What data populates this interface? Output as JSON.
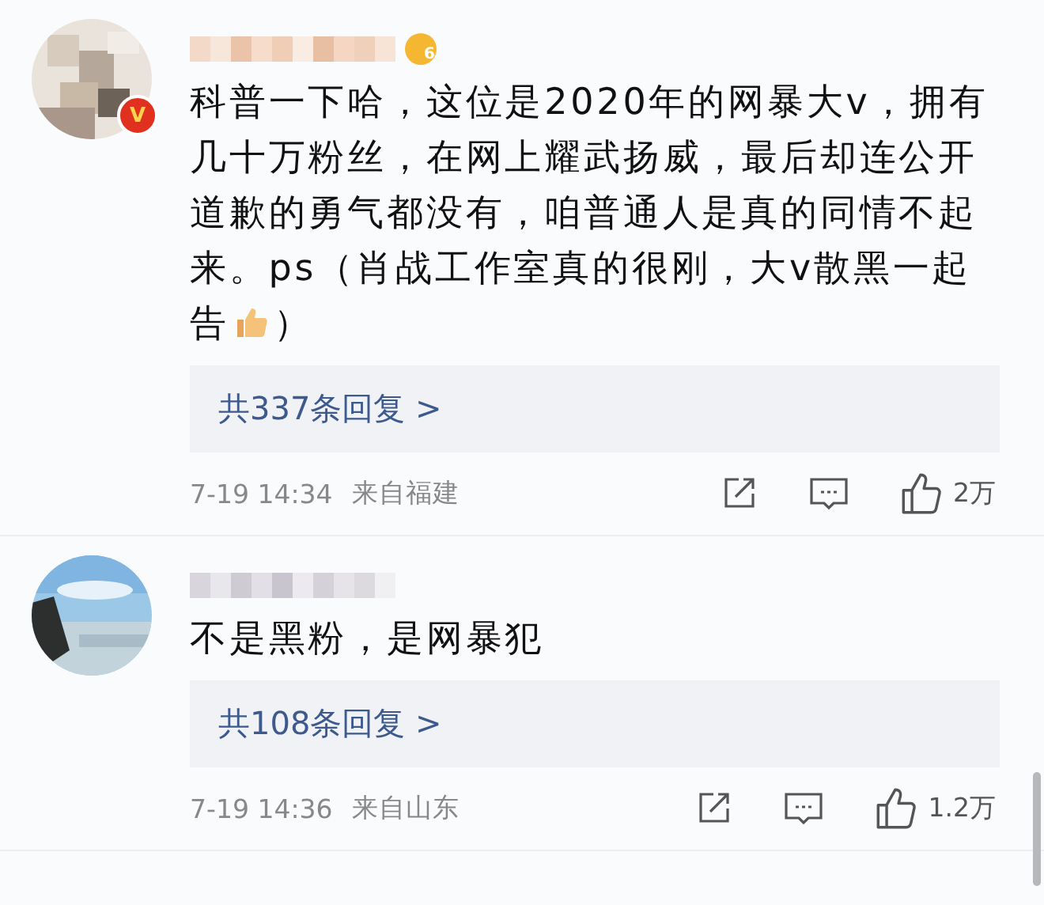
{
  "comments": [
    {
      "avatar": {
        "verified": true,
        "verified_mark": "V"
      },
      "level_badge": "6",
      "text": "科普一下哈，这位是2020年的网暴大v，拥有几十万粉丝，在网上耀武扬威，最后却连公开道歉的勇气都没有，咱普通人是真的同情不起来。ps（肖战工作室真的很刚，大v散黑一起告",
      "thumbs_emoji": true,
      "text_end": "）",
      "replies": "共337条回复 >",
      "time": "7-19 14:34",
      "location": "来自福建",
      "likes": "2万"
    },
    {
      "avatar": {
        "verified": false
      },
      "text": "不是黑粉，是网暴犯",
      "thumbs_emoji": false,
      "replies": "共108条回复 >",
      "time": "7-19 14:36",
      "location": "来自山东",
      "likes": "1.2万"
    }
  ]
}
